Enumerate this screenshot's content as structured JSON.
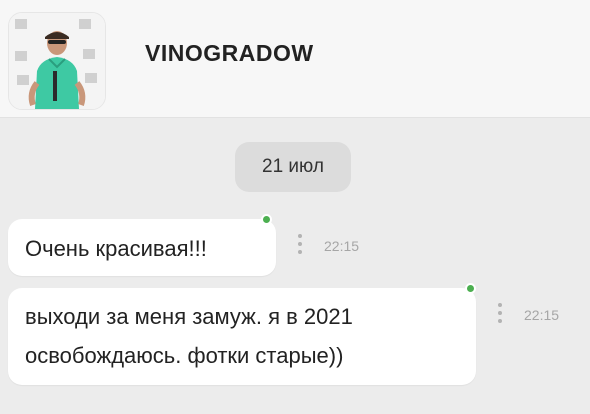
{
  "header": {
    "contact_name": "VINOGRADOW",
    "avatar_icon": "profile-photo"
  },
  "chat": {
    "date_separator": "21 июл",
    "messages": [
      {
        "text": "Очень красивая!!!",
        "time": "22:15",
        "online_indicator_color": "#4caf50"
      },
      {
        "text": "выходи за меня замуж. я в 2021 освобождаюсь. фотки старые))",
        "time": "22:15",
        "online_indicator_color": "#4caf50"
      }
    ]
  },
  "colors": {
    "background": "#ececec",
    "bubble": "#ffffff",
    "online": "#4caf50"
  }
}
